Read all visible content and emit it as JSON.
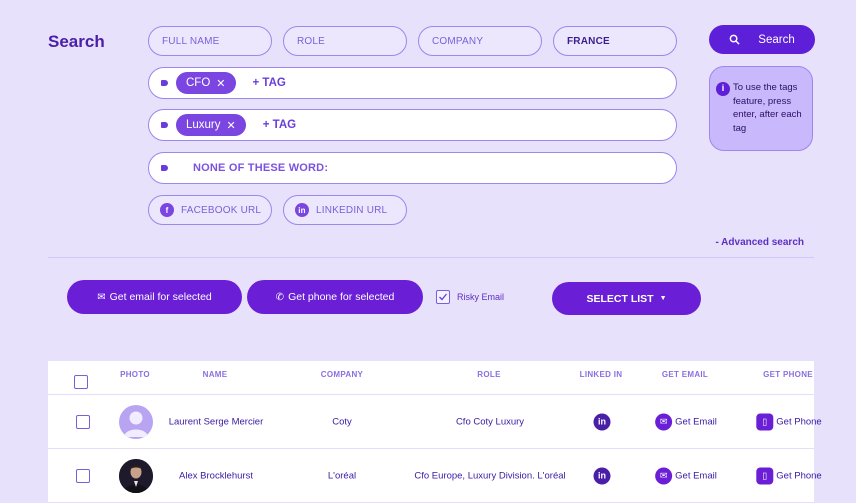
{
  "page": {
    "title": "Search"
  },
  "filters": {
    "full_name": "FULL NAME",
    "role": "ROLE",
    "company": "COMPANY",
    "country": "FRANCE",
    "tag_row_1": {
      "chip": "CFO",
      "add_tag": "+ TAG"
    },
    "tag_row_2": {
      "chip": "Luxury",
      "add_tag": "+ TAG"
    },
    "none_of_these_words": "NONE OF THESE WORD:",
    "facebook_url": "FACEBOOK URL",
    "linkedin_url": "LINKEDIN URL"
  },
  "search_button": {
    "label": "Search",
    "icon": "search-icon"
  },
  "tip": {
    "text": "To use the tags feature, press enter, after each tag",
    "icon": "info-icon"
  },
  "advanced_search": "- Advanced search",
  "actions": {
    "get_email": "Get email for selected",
    "get_phone": "Get phone for selected",
    "risky_email": "Risky Email",
    "risky_email_checked": true,
    "select_list": "SELECT LIST"
  },
  "table": {
    "columns": [
      "PHOTO",
      "NAME",
      "COMPANY",
      "ROLE",
      "LINKED IN",
      "GET EMAIL",
      "GET PHONE"
    ],
    "rows": [
      {
        "name": "Laurent Serge Mercier",
        "company": "Coty",
        "role": "Cfo Coty Luxury",
        "linkedin": "in",
        "get_email": "Get Email",
        "get_phone": "Get Phone",
        "photo": "placeholder-avatar"
      },
      {
        "name": "Alex Brocklehurst",
        "company": "L'oréal",
        "role": "Cfo Europe, Luxury Division. L'oréal",
        "linkedin": "in",
        "get_email": "Get Email",
        "get_phone": "Get Phone",
        "photo": "person-photo"
      }
    ]
  },
  "colors": {
    "background": "#e7e1fb",
    "accent": "#5d1fd8",
    "button": "#6a1fd6"
  }
}
